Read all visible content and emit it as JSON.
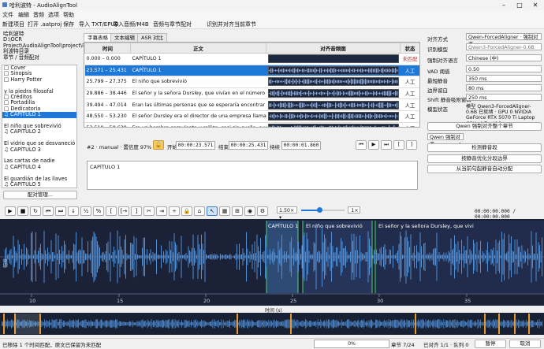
{
  "window": {
    "title": "哈利波特 - AudioAlignTool"
  },
  "menu": [
    "文件",
    "编辑",
    "音频",
    "选项",
    "帮助"
  ],
  "toolbar": [
    "新建项目",
    "打开 .aatproj",
    "保存",
    "导入 TXT/EPUB",
    "导入音频/M4B",
    "音频与章节配对",
    "识别并对齐当前章节"
  ],
  "left": {
    "book": "哈利波特",
    "path_lines": [
      "D:\\OCR",
      "Project\\AudioAlignTool\\project\\哈",
      "利波特目录"
    ],
    "section_label": "章节 / 音频配对",
    "chapters": [
      {
        "label": "□ Cover",
        "sel": false
      },
      {
        "label": "□ Sinopsis",
        "sel": false
      },
      {
        "label": "□ Harry Potter",
        "sel": false
      },
      {
        "label": "",
        "sel": false
      },
      {
        "label": "y la piedra filosofal",
        "sel": false
      },
      {
        "label": "□ Créditos",
        "sel": false
      },
      {
        "label": "□ Portadilla",
        "sel": false
      },
      {
        "label": "□ Dedicatoria",
        "sel": false
      },
      {
        "label": "♫ CAPÍTULO 1",
        "sel": true
      },
      {
        "label": "",
        "sel": false
      },
      {
        "label": "El niño que sobrevivió",
        "sel": false
      },
      {
        "label": "♫ CAPÍTULO 2",
        "sel": false
      },
      {
        "label": "",
        "sel": false
      },
      {
        "label": "El vidrio que se desvaneció",
        "sel": false
      },
      {
        "label": "♫ CAPÍTULO 3",
        "sel": false
      },
      {
        "label": "",
        "sel": false
      },
      {
        "label": "Las cartas de nadie",
        "sel": false
      },
      {
        "label": "♫ CAPÍTULO 4",
        "sel": false
      },
      {
        "label": "",
        "sel": false
      },
      {
        "label": "El guardián de las llaves",
        "sel": false
      },
      {
        "label": "♫ CAPÍTULO 5",
        "sel": false
      }
    ],
    "pair_button": "配对管理..."
  },
  "tabs": [
    "字幕表格",
    "文本编辑",
    "ASR 对比"
  ],
  "table": {
    "headers": [
      "时间",
      "正文",
      "对齐音频图",
      "状态"
    ],
    "rows": [
      {
        "time": "0.000 – 0.000",
        "text": "CAPÍTULO 1",
        "status": "未匹配",
        "sel": false
      },
      {
        "time": "23.571 – 25.431",
        "text": "CAPÍTULO 1",
        "status": "人工",
        "sel": true
      },
      {
        "time": "25.799 – 27.375",
        "text": "El niño que sobrevivió",
        "status": "人工",
        "sel": false
      },
      {
        "time": "29.886 – 38.446",
        "text": "El señor y la señora Dursley, que vivían en el número 4 de Pri...",
        "status": "人工",
        "sel": false
      },
      {
        "time": "39.494 – 47.014",
        "text": "Eran las últimas personas que se esperaría encontrar relaciona...",
        "status": "人工",
        "sel": false
      },
      {
        "time": "48.550 – 53.230",
        "text": "El señor Dursley era el director de una empresa llamada Grun...",
        "status": "人工",
        "sel": false
      },
      {
        "time": "53.519 – 58.638",
        "text": "Era un hombre corpulento y rollizo, casi sin cuello, aunque co...",
        "status": "人工",
        "sel": false
      }
    ]
  },
  "segment": {
    "info": "#2 · manual · 置信度 97%",
    "start_label": "开始",
    "start": "00:00:23.571",
    "end_label": "结束",
    "end": "00:00:25.431",
    "dur_label": "持续",
    "dur": "00:00:01.860",
    "text": "CAPÍTULO 1"
  },
  "right": {
    "fields": [
      {
        "label": "对齐方式",
        "value": "Qwen-ForcedAligner · 强制对齐"
      },
      {
        "label": "识别模型",
        "value": "Qwen3-ForcedAligner-0.6B"
      },
      {
        "label": "强制对齐语言",
        "value": "Chinese (中)"
      },
      {
        "label": "VAD 阈值",
        "value": "0.50"
      },
      {
        "label": "最短静音",
        "value": "350 ms"
      },
      {
        "label": "边界留白",
        "value": "80 ms"
      },
      {
        "label": "Shift 静音吸附窗口",
        "value": "250 ms"
      }
    ],
    "model_status_label": "模型状态",
    "model_status": "模型 Qwen3-ForcedAligner-0.6B 已就绪 · GPU 0 NVIDIA GeForce RTX 5070 Ti Laptop GPU · bfloat16",
    "btn_align_chapter": "Qwen 强制对齐整个章节",
    "mode_select": "Qwen 强制对齐",
    "btn_check": "检测静音段",
    "btn_split": "按静音优化分段边界",
    "btn_realign": "从当前句起静音自动分配"
  },
  "playback": {
    "zoom": "1.50×",
    "speed": "1×",
    "time": "00:00:00.000 / 00:00:00.000"
  },
  "waveform": {
    "ylabel": "幅度",
    "xlabel": "时间 (s)",
    "ticks": [
      "10",
      "15",
      "20",
      "25",
      "30",
      "35"
    ],
    "segments": [
      {
        "label": "CAPÍTULO 1"
      },
      {
        "label": "El niño que sobrevivió"
      },
      {
        "label": "El señor y la señora Dursley, que vivi"
      }
    ]
  },
  "status": {
    "message": "已移除 1 个时间匹配，原文已保留为未匹配",
    "progress": "0%",
    "chapter": "章节 7/24",
    "ch_status": "已对齐 1/1 · 队列 0",
    "btn_pause": "暂停",
    "btn_cancel": "取消"
  },
  "colors": {
    "accent": "#1e78d7",
    "wave_bg": "#1b2238",
    "wave": "#4f8fd6",
    "marker": "#e8962e"
  }
}
